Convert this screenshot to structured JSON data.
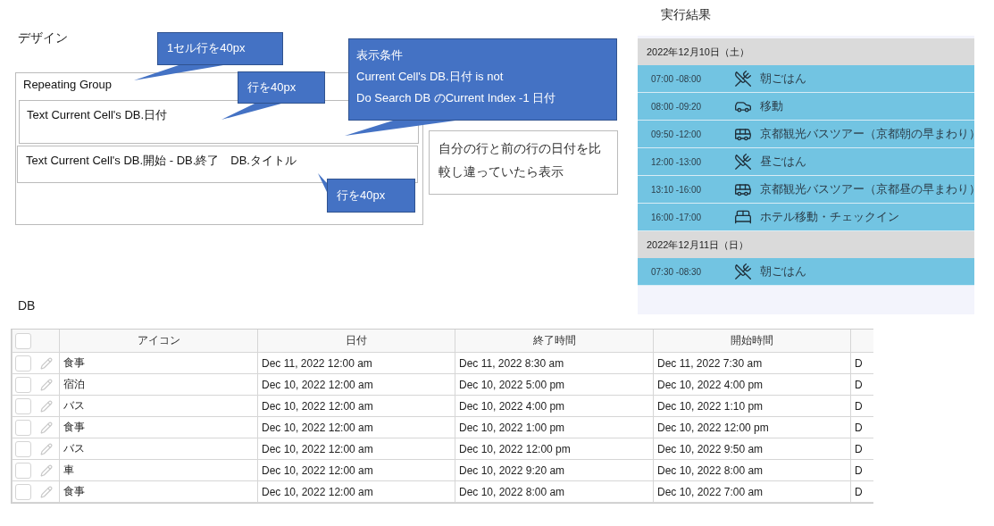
{
  "design": {
    "title": "デザイン",
    "repeating_group": {
      "label": "Repeating Group",
      "cells": [
        "Text Current Cell's DB.日付",
        "Text Current Cell's DB.開始 - DB.終了　DB.タイトル"
      ]
    },
    "note": "自分の行と前の行の日付を比較し違っていたら表示",
    "callouts": [
      {
        "lines": [
          "1セル行を40px"
        ]
      },
      {
        "lines": [
          "行を40px"
        ]
      },
      {
        "lines": [
          "表示条件",
          "Current Cell's DB.日付 is not",
          "Do Search DB のCurrent Index -1 日付"
        ]
      },
      {
        "lines": [
          "行を40px"
        ]
      }
    ]
  },
  "result": {
    "title": "実行結果",
    "groups": [
      {
        "date": "2022年12月10日（土）",
        "items": [
          {
            "time": "07:00 -08:00",
            "kind": "meal",
            "title": "朝ごはん"
          },
          {
            "time": "08:00 -09:20",
            "kind": "car",
            "title": "移動"
          },
          {
            "time": "09:50 -12:00",
            "kind": "bus",
            "title": "京都観光バスツアー（京都朝の早まわり）"
          },
          {
            "time": "12:00 -13:00",
            "kind": "meal",
            "title": "昼ごはん"
          },
          {
            "time": "13:10 -16:00",
            "kind": "bus",
            "title": "京都観光バスツアー（京都昼の早まわり）"
          },
          {
            "time": "16:00 -17:00",
            "kind": "hotel",
            "title": "ホテル移動・チェックイン"
          }
        ]
      },
      {
        "date": "2022年12月11日（日）",
        "items": [
          {
            "time": "07:30 -08:30",
            "kind": "meal",
            "title": "朝ごはん"
          }
        ]
      }
    ]
  },
  "db": {
    "title": "DB",
    "all_checked": false,
    "columns": [
      "アイコン",
      "日付",
      "終了時間",
      "開始時間"
    ],
    "rows": [
      {
        "checked": false,
        "cells": [
          "食事",
          "Dec 11, 2022 12:00 am",
          "Dec 11, 2022 8:30 am",
          "Dec 11, 2022 7:30 am",
          "D"
        ]
      },
      {
        "checked": false,
        "cells": [
          "宿泊",
          "Dec 10, 2022 12:00 am",
          "Dec 10, 2022 5:00 pm",
          "Dec 10, 2022 4:00 pm",
          "D"
        ]
      },
      {
        "checked": false,
        "cells": [
          "バス",
          "Dec 10, 2022 12:00 am",
          "Dec 10, 2022 4:00 pm",
          "Dec 10, 2022 1:10 pm",
          "D"
        ]
      },
      {
        "checked": false,
        "cells": [
          "食事",
          "Dec 10, 2022 12:00 am",
          "Dec 10, 2022 1:00 pm",
          "Dec 10, 2022 12:00 pm",
          "D"
        ]
      },
      {
        "checked": false,
        "cells": [
          "バス",
          "Dec 10, 2022 12:00 am",
          "Dec 10, 2022 12:00 pm",
          "Dec 10, 2022 9:50 am",
          "D"
        ]
      },
      {
        "checked": false,
        "cells": [
          "車",
          "Dec 10, 2022 12:00 am",
          "Dec 10, 2022 9:20 am",
          "Dec 10, 2022 8:00 am",
          "D"
        ]
      },
      {
        "checked": false,
        "cells": [
          "食事",
          "Dec 10, 2022 12:00 am",
          "Dec 10, 2022 8:00 am",
          "Dec 10, 2022 7:00 am",
          "D"
        ]
      }
    ]
  }
}
